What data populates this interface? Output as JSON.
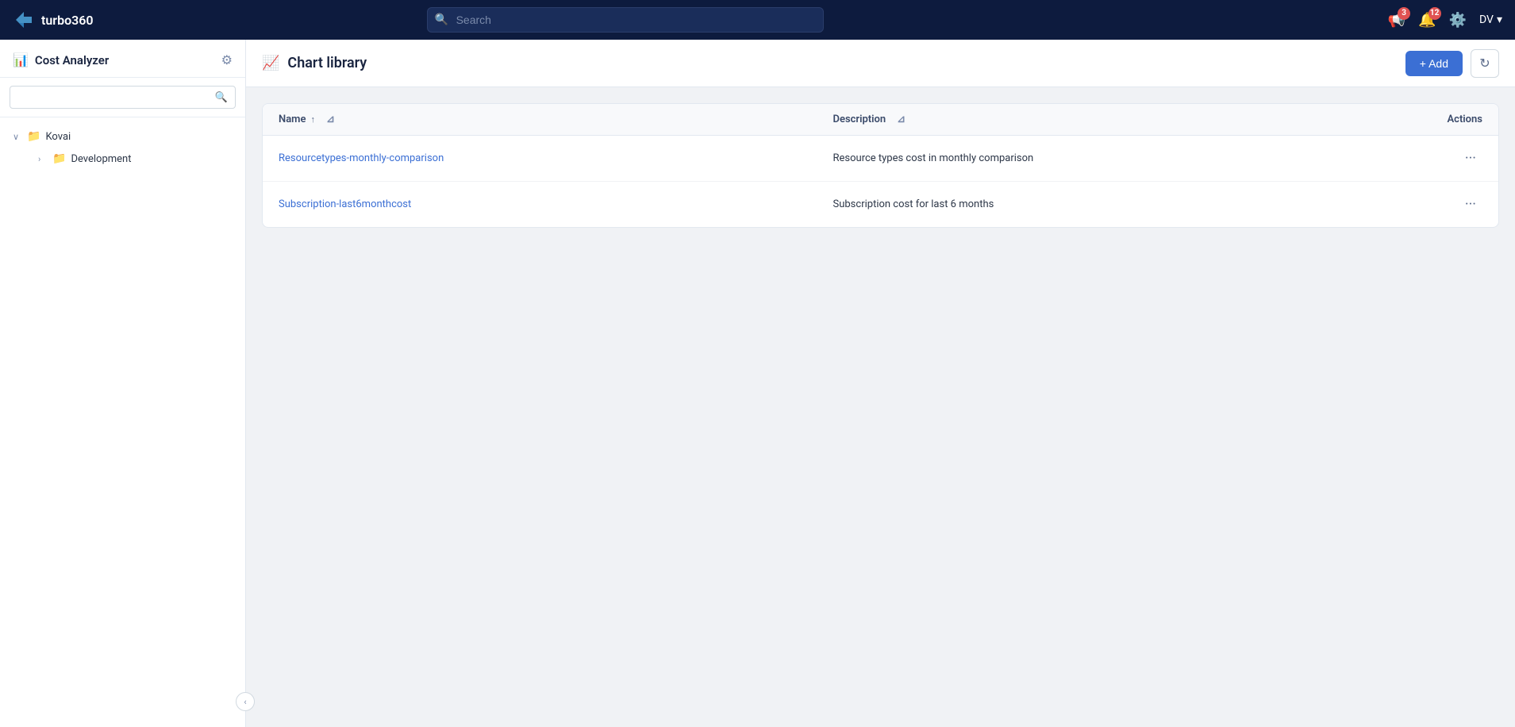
{
  "app": {
    "name": "turbo360",
    "logo_text": "turbo360"
  },
  "nav": {
    "search_placeholder": "Search",
    "notifications_badge": "3",
    "alerts_badge": "12",
    "user_initials": "DV",
    "user_dropdown_arrow": "▾"
  },
  "sidebar": {
    "title": "Cost Analyzer",
    "search_placeholder": "",
    "tree": [
      {
        "label": "Kovai",
        "expanded": true,
        "folder_color": "red",
        "children": [
          {
            "label": "Development",
            "expanded": false,
            "folder_color": "gray"
          }
        ]
      }
    ],
    "collapse_icon": "‹"
  },
  "main": {
    "page_title": "Chart library",
    "add_button_label": "+ Add",
    "refresh_tooltip": "Refresh",
    "table": {
      "columns": [
        {
          "label": "Name",
          "sortable": true,
          "filterable": true
        },
        {
          "label": "Description",
          "sortable": false,
          "filterable": true
        },
        {
          "label": "Actions",
          "sortable": false,
          "filterable": false
        }
      ],
      "rows": [
        {
          "name": "Resourcetypes-monthly-comparison",
          "description": "Resource types cost in monthly comparison"
        },
        {
          "name": "Subscription-last6monthcost",
          "description": "Subscription cost for last 6 months"
        }
      ]
    }
  }
}
